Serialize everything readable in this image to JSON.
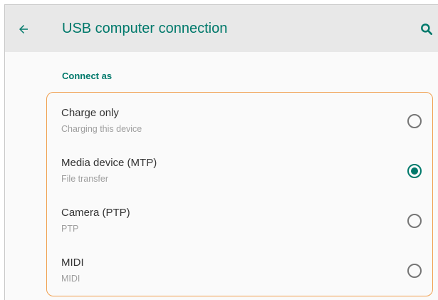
{
  "toolbar": {
    "title": "USB computer connection",
    "back_icon": "arrow-left-icon",
    "search_icon": "search-icon"
  },
  "section": {
    "header": "Connect as"
  },
  "options": [
    {
      "label": "Charge only",
      "sublabel": "Charging this device",
      "checked": false
    },
    {
      "label": "Media device (MTP)",
      "sublabel": "File transfer",
      "checked": true
    },
    {
      "label": "Camera (PTP)",
      "sublabel": "PTP",
      "checked": false
    },
    {
      "label": "MIDI",
      "sublabel": "MIDI",
      "checked": false
    }
  ],
  "colors": {
    "accent": "#00796b",
    "highlight_border": "#f0a050",
    "toolbar_bg": "#e8e8e8"
  }
}
